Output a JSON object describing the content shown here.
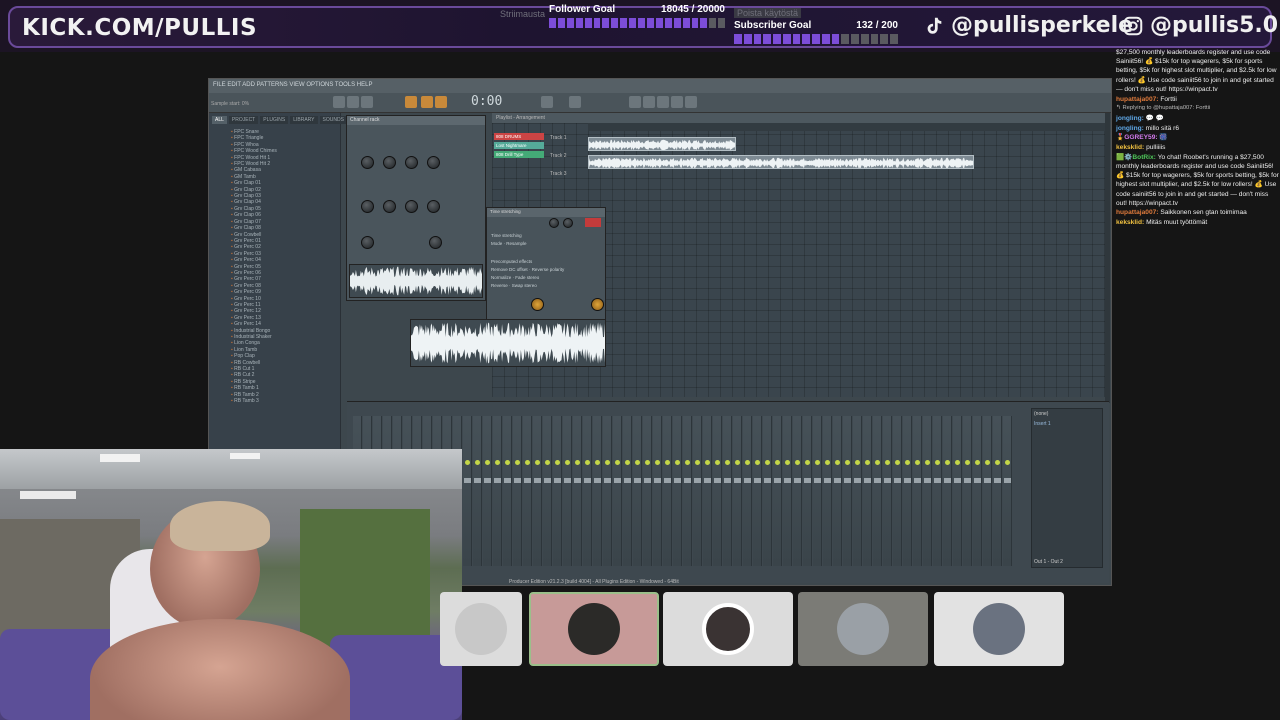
{
  "overlay": {
    "brand": "KICK.COM/PULLIS",
    "follower_goal": {
      "label": "Follower Goal",
      "count": "18045 / 20000",
      "fraction": 0.9
    },
    "subscriber_goal": {
      "label": "Subscriber Goal",
      "count": "132 / 200",
      "fraction": 0.66
    },
    "ghost_text_1": "Striimausta",
    "ghost_text_2": "Poista käytöstä",
    "tiktok_handle": "@pullisperkele",
    "instagram_handle": "@pullis5.0",
    "accent_color": "#7c4dd8"
  },
  "daw": {
    "title": "FILE EDIT ADD PATTERNS VIEW OPTIONS TOOLS HELP",
    "hint": "Sample start: 0%",
    "time": "0:00",
    "time_sub": "00",
    "browser_tabs": [
      "ALL",
      "PROJECT",
      "PLUGINS",
      "LIBRARY",
      "SOUNDS",
      "STARRED"
    ],
    "browser_items": [
      "FPC Snare",
      "FPC Triangle",
      "FPC Whoa",
      "FPC Wood Chimes",
      "FPC Wood Hit 1",
      "FPC Wood Hit 2",
      "GM Cabasa",
      "GM Tamb",
      "Grv Clap 01",
      "Grv Clap 02",
      "Grv Clap 03",
      "Grv Clap 04",
      "Grv Clap 05",
      "Grv Clap 06",
      "Grv Clap 07",
      "Grv Clap 08",
      "Grv Cowbell",
      "Grv Perc 01",
      "Grv Perc 02",
      "Grv Perc 03",
      "Grv Perc 04",
      "Grv Perc 05",
      "Grv Perc 06",
      "Grv Perc 07",
      "Grv Perc 08",
      "Grv Perc 09",
      "Grv Perc 10",
      "Grv Perc 11",
      "Grv Perc 12",
      "Grv Perc 13",
      "Grv Perc 14",
      "Industrial Bongo",
      "Industrial Shaker",
      "Lion Conga",
      "Lion Tamb",
      "Pop Clap",
      "RB Cowbell",
      "RB Cut 1",
      "RB Cut 2",
      "RB Stripe",
      "RB Tamb 1",
      "RB Tamb 2",
      "RB Tamb 3"
    ],
    "playlist_header": "Playlist - Arrangement",
    "channel_rack_title": "Channel rack",
    "track_labels": [
      "Track 1",
      "Track 2",
      "Track 3"
    ],
    "clip_names": [
      "808 DRUMS",
      "Lost Nightmare",
      "808 Drill Type"
    ],
    "fx_title": "Time stretching",
    "fx_labels": [
      "Time stretching",
      "Mode",
      "Resample",
      "Precomputed effects",
      "Remove DC offset",
      "Reverse polarity",
      "Normalize",
      "Fade stereo",
      "Reverse",
      "Swap stereo"
    ],
    "status": "Producer Edition v21.2.3 [build 4004] - All Plugins Edition - Windowed - 64Bit",
    "mixer_side_labels": [
      "(none)",
      "Insert 1",
      "Out 1 - Out 2"
    ]
  },
  "chat": [
    {
      "user": "",
      "text": "$27,500 monthly leaderboards register and use code Sainiit56! 💰 $15k for top wagerers, $5k for sports betting, $5k for highest slot multiplier, and $2.5k for low rollers! 💰 Use code sainiit56 to join in and get started — don't miss out! https://winpact.tv",
      "color": "#eeeeee"
    },
    {
      "user": "hupattaja007:",
      "text": "Forttii",
      "color": "#e07b3c"
    },
    {
      "user": "",
      "text": "↰ Replying to @hupattaja007: Forttii",
      "color": "#bbbbbb",
      "reply": true
    },
    {
      "user": "jongling:",
      "text": "💬 💬",
      "color": "#5fa8e8"
    },
    {
      "user": "jongling:",
      "text": "millo sitä r6",
      "color": "#5fa8e8"
    },
    {
      "user": "🎖️GGREY59:",
      "text": "🎆",
      "color": "#d47cf0"
    },
    {
      "user": "keksklid:",
      "text": "pulliiiis",
      "color": "#f0c040"
    },
    {
      "user": "🟩⚙️BotRix:",
      "text": "Yo chat! Roobet's running a $27,500 monthly leaderboards register and use code Sainiit56! 💰 $15k for top wagerers, $5k for sports betting, $5k for highest slot multiplier, and $2.5k for low rollers! 💰 Use code sainiit56 to join in and get started — don't miss out! https://winpact.tv",
      "color": "#4ec85a"
    },
    {
      "user": "hupattaja007:",
      "text": "Saikkonen sen gtan toimimaa",
      "color": "#e07b3c"
    },
    {
      "user": "keksklid:",
      "text": "Mitäs muut työttömät",
      "color": "#f0c040"
    }
  ],
  "guests": [
    {
      "name": "guest-1",
      "bg": "#d9d9d9",
      "avatar": "#c8c8c8"
    },
    {
      "name": "guest-2-active",
      "bg": "#c79a98",
      "avatar": "#2b2a28"
    },
    {
      "name": "guest-3",
      "bg": "#dcdcdc",
      "avatar": "#3a3333"
    },
    {
      "name": "guest-4",
      "bg": "#7b7b76",
      "avatar": "#9aa0a6"
    },
    {
      "name": "guest-5",
      "bg": "#e2e2e2",
      "avatar": "#6a7280"
    }
  ]
}
